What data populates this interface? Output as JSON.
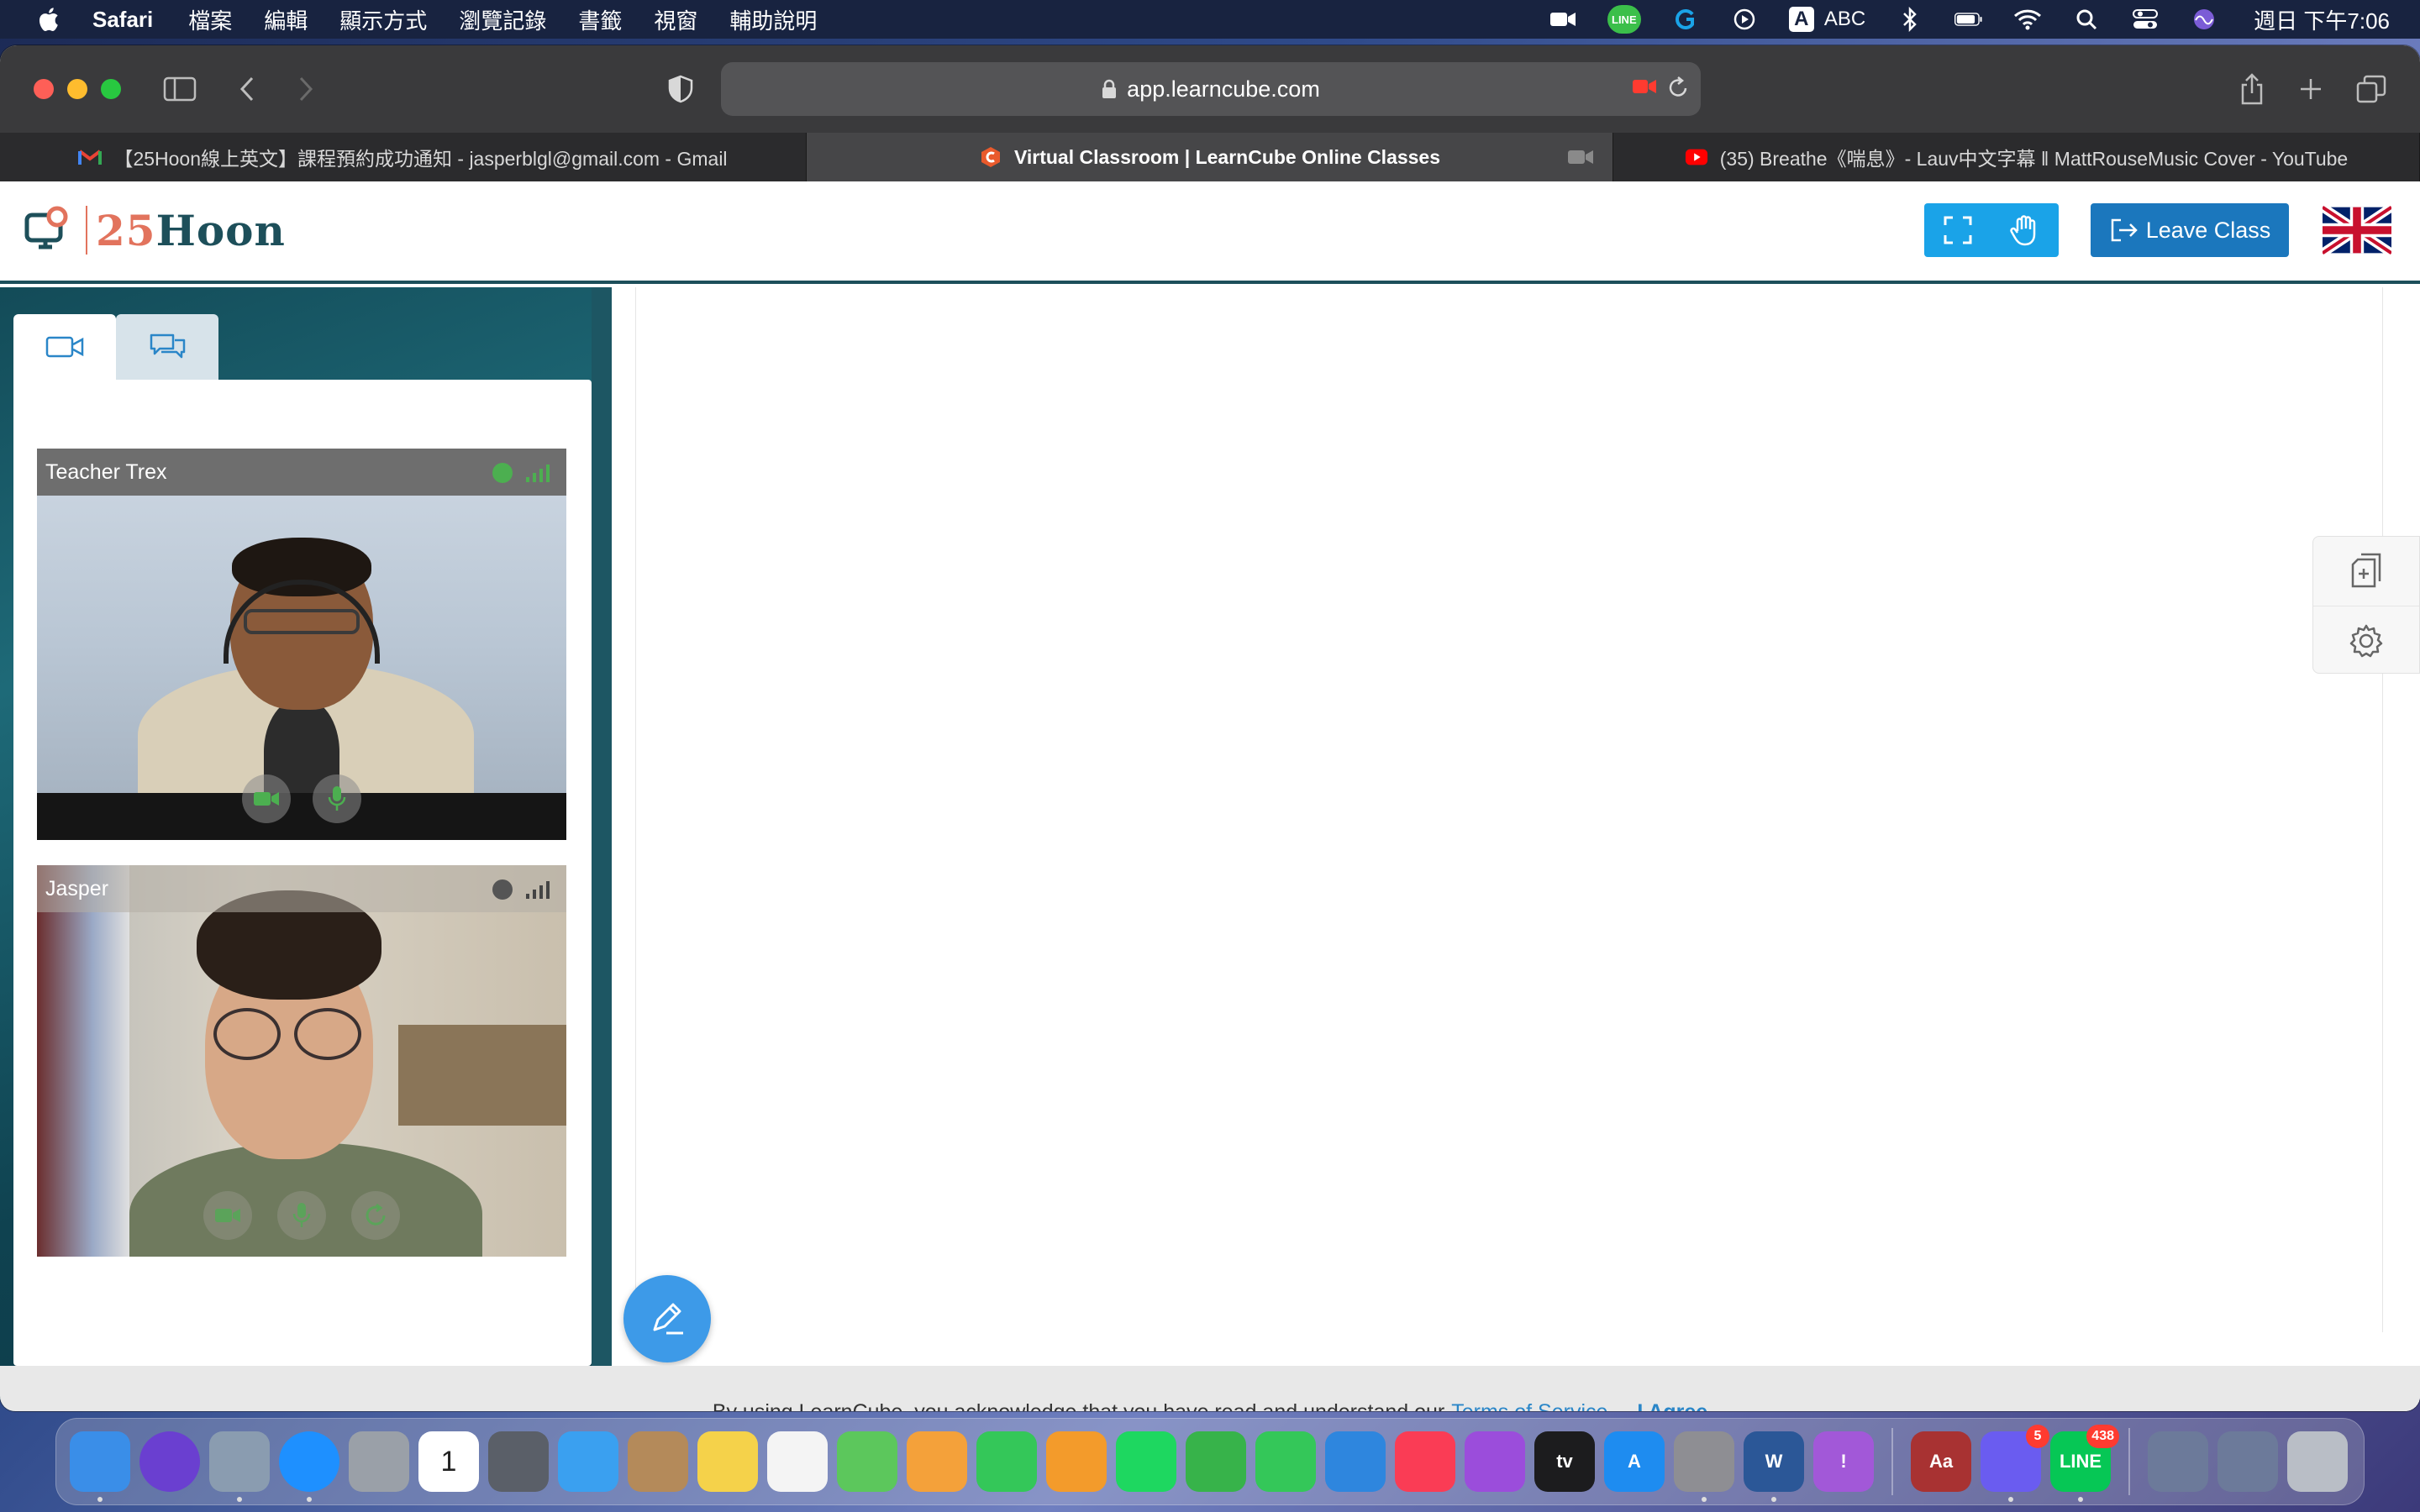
{
  "menubar": {
    "app_name": "Safari",
    "menus": [
      "檔案",
      "編輯",
      "顯示方式",
      "瀏覽記錄",
      "書籤",
      "視窗",
      "輔助說明"
    ],
    "input_method": "ABC",
    "input_method_letter": "A",
    "line_label": "LINE",
    "clock": "週日 下午7:06"
  },
  "browser": {
    "url": "app.learncube.com",
    "tabs": [
      {
        "title": "【25Hoon線上英文】課程預約成功通知 - jasperblgl@gmail.com - Gmail",
        "favicon": "gmail-icon"
      },
      {
        "title": "Virtual Classroom | LearnCube Online Classes",
        "favicon": "learncube-icon",
        "active": true
      },
      {
        "title": "(35) Breathe《喘息》- Lauv中文字幕 ‖ MattRouseMusic Cover - YouTube",
        "favicon": "youtube-icon"
      }
    ]
  },
  "page": {
    "logo_num": "25",
    "logo_word": "Hoon",
    "leave_label": "Leave Class",
    "participants": [
      {
        "name": "Teacher Trex",
        "status_color": "#4caf50"
      },
      {
        "name": "Jasper",
        "status_color": "#555555"
      }
    ],
    "consent_text": "By using LearnCube, you acknowledge that you have read and understand our",
    "consent_link": "Terms of Service.",
    "consent_agree": "I Agree"
  },
  "dock": {
    "items": [
      {
        "name": "finder-icon",
        "color": "#3a8ee8",
        "label": ""
      },
      {
        "name": "siri-icon",
        "color": "#6a3fd0",
        "label": ""
      },
      {
        "name": "preview-icon",
        "color": "#8a9cb0",
        "label": ""
      },
      {
        "name": "safari-icon",
        "color": "#1e90ff",
        "label": ""
      },
      {
        "name": "launchpad-icon",
        "color": "#9aa0a8",
        "label": ""
      },
      {
        "name": "calendar-icon",
        "color": "#ffffff",
        "label": "1"
      },
      {
        "name": "quicktime-icon",
        "color": "#5a5f68",
        "label": ""
      },
      {
        "name": "mail-icon",
        "color": "#3aa0f0",
        "label": ""
      },
      {
        "name": "contacts-icon",
        "color": "#b48a5a",
        "label": ""
      },
      {
        "name": "notes-icon",
        "color": "#f5d24a",
        "label": ""
      },
      {
        "name": "reminders-icon",
        "color": "#f4f4f4",
        "label": ""
      },
      {
        "name": "maps-icon",
        "color": "#5cc75c",
        "label": ""
      },
      {
        "name": "photos-icon",
        "color": "#f4a13a",
        "label": ""
      },
      {
        "name": "messages-icon",
        "color": "#34c759",
        "label": ""
      },
      {
        "name": "pages-icon",
        "color": "#f39b2b",
        "label": ""
      },
      {
        "name": "spotify-icon",
        "color": "#1ed760",
        "label": ""
      },
      {
        "name": "numbers-icon",
        "color": "#37b34a",
        "label": ""
      },
      {
        "name": "facetime-icon",
        "color": "#34c759",
        "label": ""
      },
      {
        "name": "keynote-icon",
        "color": "#2e86de",
        "label": ""
      },
      {
        "name": "music-icon",
        "color": "#fa3c55",
        "label": ""
      },
      {
        "name": "podcasts-icon",
        "color": "#9b4ddb",
        "label": ""
      },
      {
        "name": "appletv-icon",
        "color": "#1c1c1e",
        "label": "tv"
      },
      {
        "name": "appstore-icon",
        "color": "#1e8cf0",
        "label": "A"
      },
      {
        "name": "system-preferences-icon",
        "color": "#8e8e93",
        "label": ""
      },
      {
        "name": "word-icon",
        "color": "#2b5797",
        "label": "W"
      },
      {
        "name": "feedback-icon",
        "color": "#a258d8",
        "label": "!"
      },
      {
        "name": "dictionary-icon",
        "color": "#a83232",
        "label": "Aa"
      },
      {
        "name": "messenger-icon",
        "color": "#6a5cf0",
        "label": "",
        "badge": "5"
      },
      {
        "name": "line-icon",
        "color": "#06c755",
        "label": "LINE",
        "badge": "438"
      },
      {
        "name": "word-document-icon",
        "color": "#6c7a9a",
        "label": ""
      },
      {
        "name": "screenshot-icon",
        "color": "#6c7a9a",
        "label": ""
      },
      {
        "name": "trash-icon",
        "color": "#b9bec6",
        "label": ""
      }
    ]
  }
}
